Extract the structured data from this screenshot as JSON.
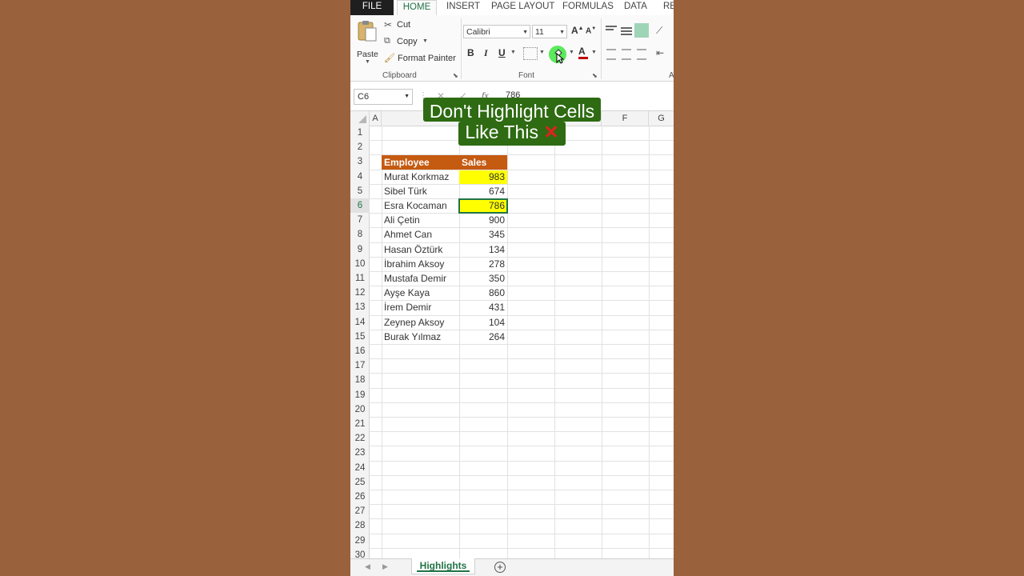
{
  "ribbon": {
    "tabs": [
      "FILE",
      "HOME",
      "INSERT",
      "PAGE LAYOUT",
      "FORMULAS",
      "DATA",
      "RE"
    ],
    "active_tab": "HOME",
    "clipboard": {
      "paste": "Paste",
      "cut": "Cut",
      "copy": "Copy",
      "format_painter": "Format Painter",
      "group_label": "Clipboard"
    },
    "font": {
      "family": "Calibri",
      "size": "11",
      "bold": "B",
      "italic": "I",
      "underline": "U",
      "grow": "A",
      "shrink": "A",
      "font_color": "A",
      "group_label": "Font"
    },
    "alignment_label": "A",
    "highlight_color": "#ffff00",
    "accent_color": "#217346"
  },
  "formula_bar": {
    "name_box": "C6",
    "fx": "fx",
    "value": "786"
  },
  "grid": {
    "columns": [
      "A",
      "",
      "",
      "",
      "",
      "F",
      "G"
    ],
    "rows": [
      "1",
      "2",
      "3",
      "4",
      "5",
      "6",
      "7",
      "8",
      "9",
      "10",
      "11",
      "12",
      "13",
      "14",
      "15",
      "16",
      "17",
      "18",
      "19",
      "20",
      "21",
      "22",
      "23",
      "24",
      "25",
      "26",
      "27",
      "28",
      "29",
      "30"
    ],
    "selected_row": "6",
    "header": {
      "employee": "Employee",
      "sales": "Sales",
      "color": "#c55a11"
    },
    "data": [
      {
        "name": "Murat Korkmaz",
        "sales": "983",
        "highlighted": true
      },
      {
        "name": "Sibel Türk",
        "sales": "674",
        "highlighted": false
      },
      {
        "name": "Esra Kocaman",
        "sales": "786",
        "highlighted": true
      },
      {
        "name": "Ali Çetin",
        "sales": "900",
        "highlighted": false
      },
      {
        "name": "Ahmet Can",
        "sales": "345",
        "highlighted": false
      },
      {
        "name": "Hasan Öztürk",
        "sales": "134",
        "highlighted": false
      },
      {
        "name": "İbrahim Aksoy",
        "sales": "278",
        "highlighted": false
      },
      {
        "name": "Mustafa Demir",
        "sales": "350",
        "highlighted": false
      },
      {
        "name": "Ayşe Kaya",
        "sales": "860",
        "highlighted": false
      },
      {
        "name": "İrem Demir",
        "sales": "431",
        "highlighted": false
      },
      {
        "name": "Zeynep Aksoy",
        "sales": "104",
        "highlighted": false
      },
      {
        "name": "Burak Yılmaz",
        "sales": "264",
        "highlighted": false
      }
    ]
  },
  "sheets": {
    "active": "Highlights"
  },
  "caption": {
    "line1": "Don't Highlight Cells",
    "line2": "Like This",
    "mark": "✕",
    "background": "#2e6b12"
  }
}
